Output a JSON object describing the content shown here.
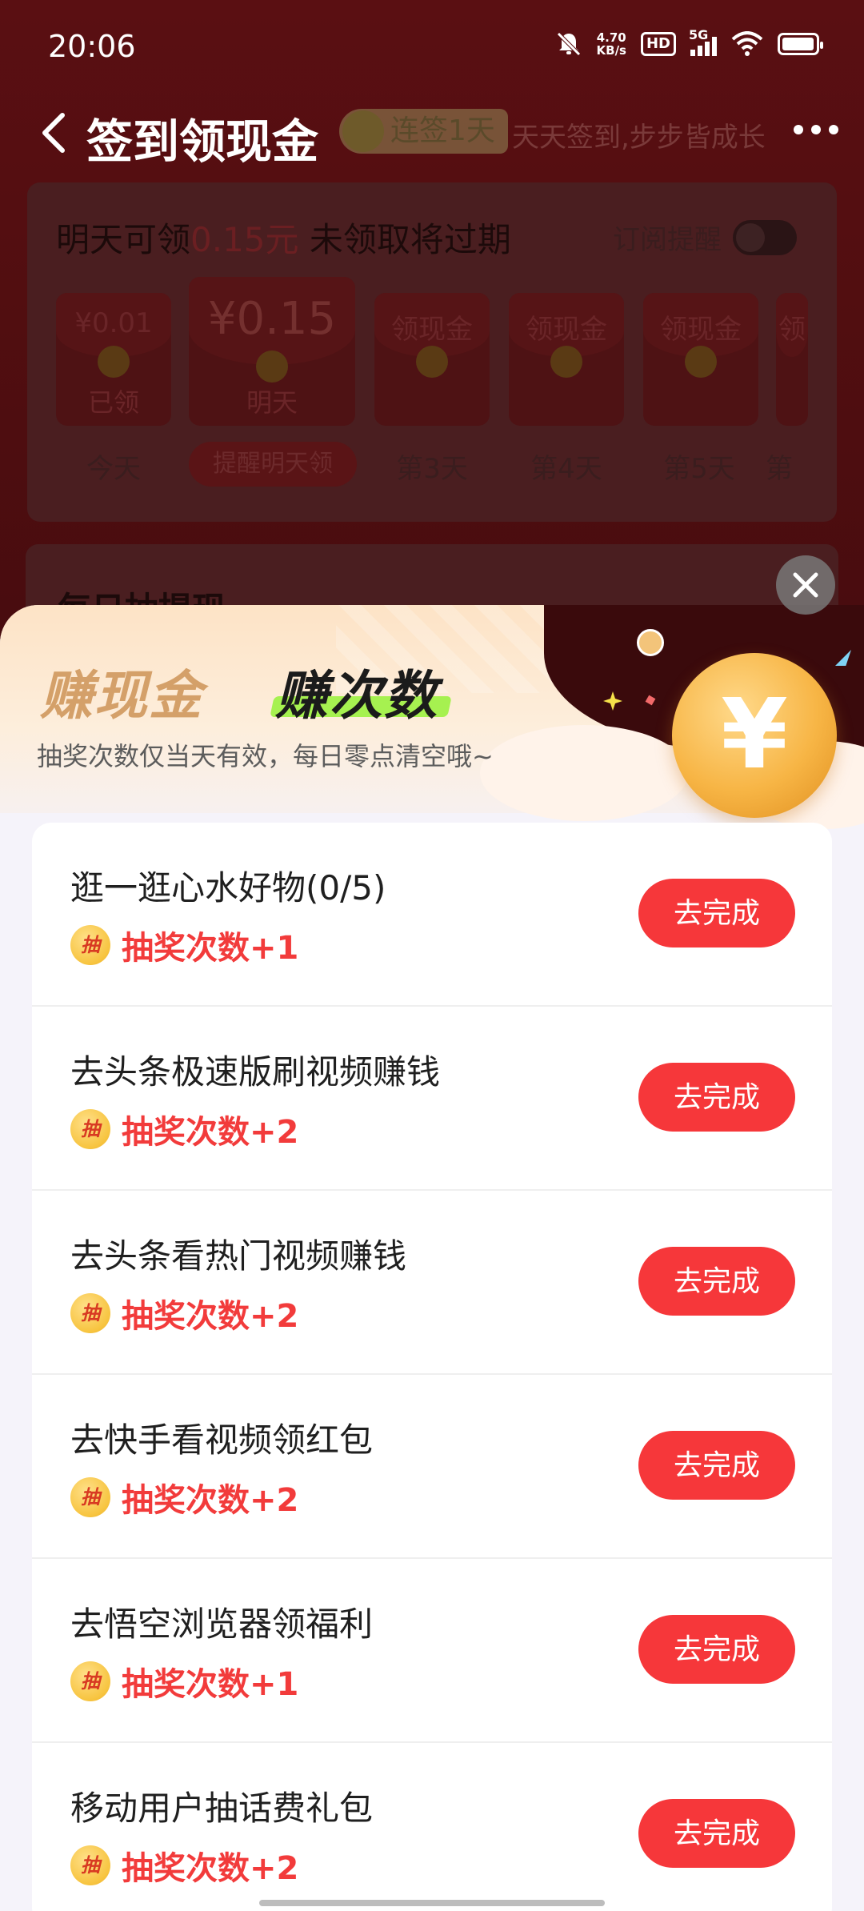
{
  "status": {
    "time": "20:06",
    "speed_value": "4.70",
    "speed_unit": "KB/s",
    "hd": "HD",
    "network": "5G"
  },
  "nav": {
    "title": "签到领现金",
    "streak": "连签1天",
    "slogan": "天天签到,步步皆成长"
  },
  "signin": {
    "head_prefix": "明天可领",
    "head_amount": "0.15元",
    "head_suffix": " 未领取将过期",
    "subscribe_label": "订阅提醒",
    "envelopes": [
      {
        "top": "¥0.01",
        "bottom": "已领",
        "day": "今天"
      },
      {
        "top": "¥0.15",
        "bottom": "明天",
        "day": "提醒明天领"
      },
      {
        "top": "领现金",
        "bottom": "",
        "day": "第3天"
      },
      {
        "top": "领现金",
        "bottom": "",
        "day": "第4天"
      },
      {
        "top": "领现金",
        "bottom": "",
        "day": "第5天"
      },
      {
        "top": "领",
        "bottom": "",
        "day": "第"
      }
    ]
  },
  "withdraw": {
    "title": "每日抽提现"
  },
  "sheet": {
    "tab_cash": "赚现金",
    "tab_count": "赚次数",
    "subtitle": "抽奖次数仅当天有效，每日零点清空哦~",
    "coin_symbol": "¥",
    "chou_icon_text": "抽",
    "tasks": [
      {
        "name": "逛一逛心水好物(0/5)",
        "reward": "抽奖次数+1",
        "button": "去完成"
      },
      {
        "name": "去头条极速版刷视频赚钱",
        "reward": "抽奖次数+2",
        "button": "去完成"
      },
      {
        "name": "去头条看热门视频赚钱",
        "reward": "抽奖次数+2",
        "button": "去完成"
      },
      {
        "name": "去快手看视频领红包",
        "reward": "抽奖次数+2",
        "button": "去完成"
      },
      {
        "name": "去悟空浏览器领福利",
        "reward": "抽奖次数+1",
        "button": "去完成"
      },
      {
        "name": "移动用户抽话费礼包",
        "reward": "抽奖次数+2",
        "button": "去完成"
      }
    ]
  },
  "colors": {
    "accent_red": "#f6373a",
    "reward_red": "#f23b3b",
    "tab_gold": "#d4a069",
    "tab_underline_green": "#a6f150"
  }
}
